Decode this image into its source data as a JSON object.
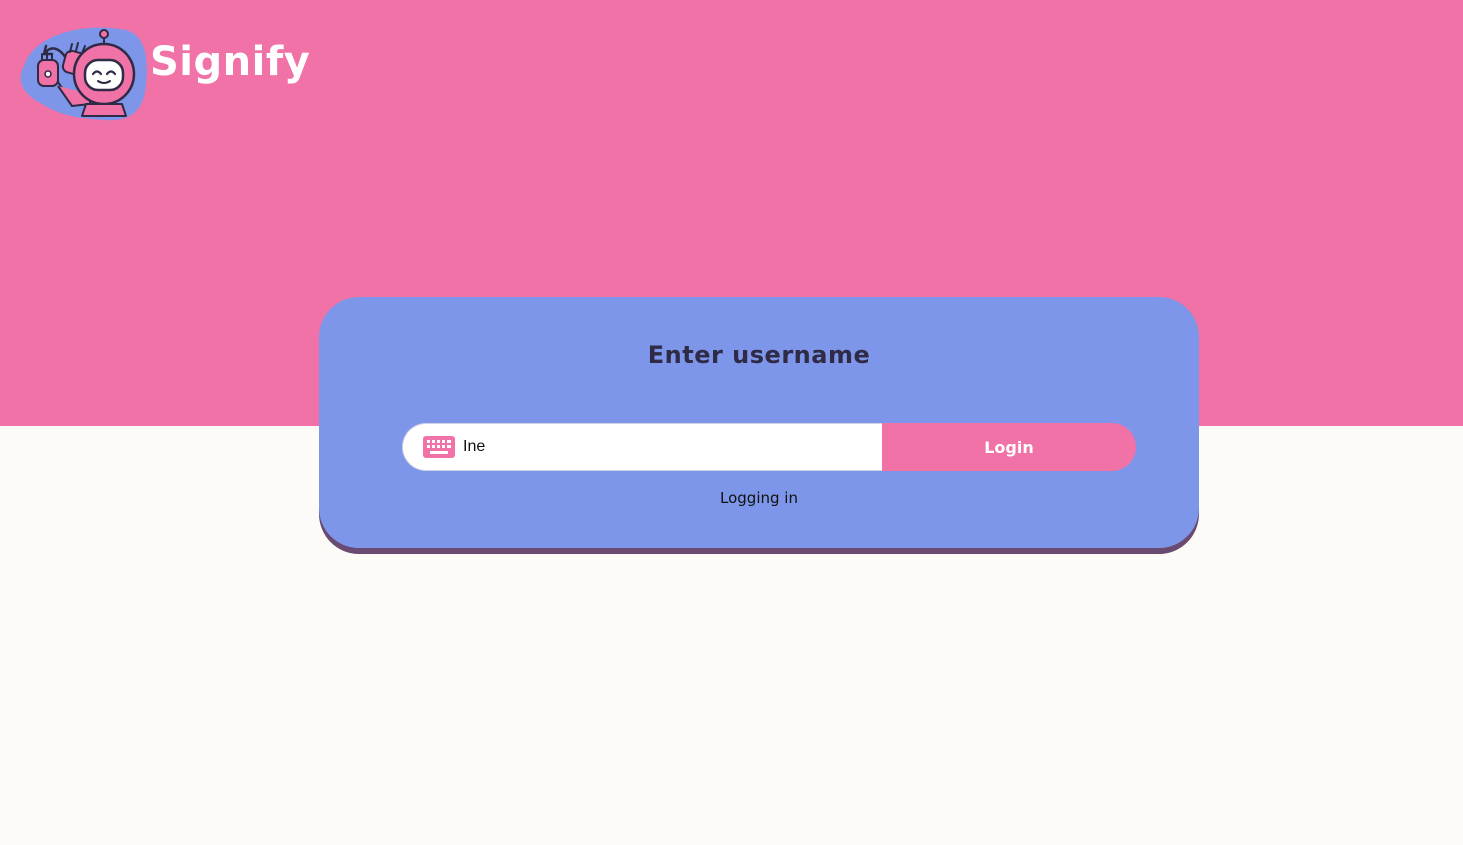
{
  "header": {
    "brand_name": "Signify",
    "logo_icon": "robot-signing-hands-icon"
  },
  "login": {
    "title": "Enter username",
    "input_icon": "keyboard-icon",
    "username_value": "Ine",
    "login_label": "Login",
    "status": "Logging in"
  },
  "colors": {
    "primary_pink": "#f072a6",
    "card_blue": "#7e96e9",
    "card_shadow": "#6a4a70",
    "page_background": "#fcfbf7",
    "title_text": "#2f2a45"
  }
}
